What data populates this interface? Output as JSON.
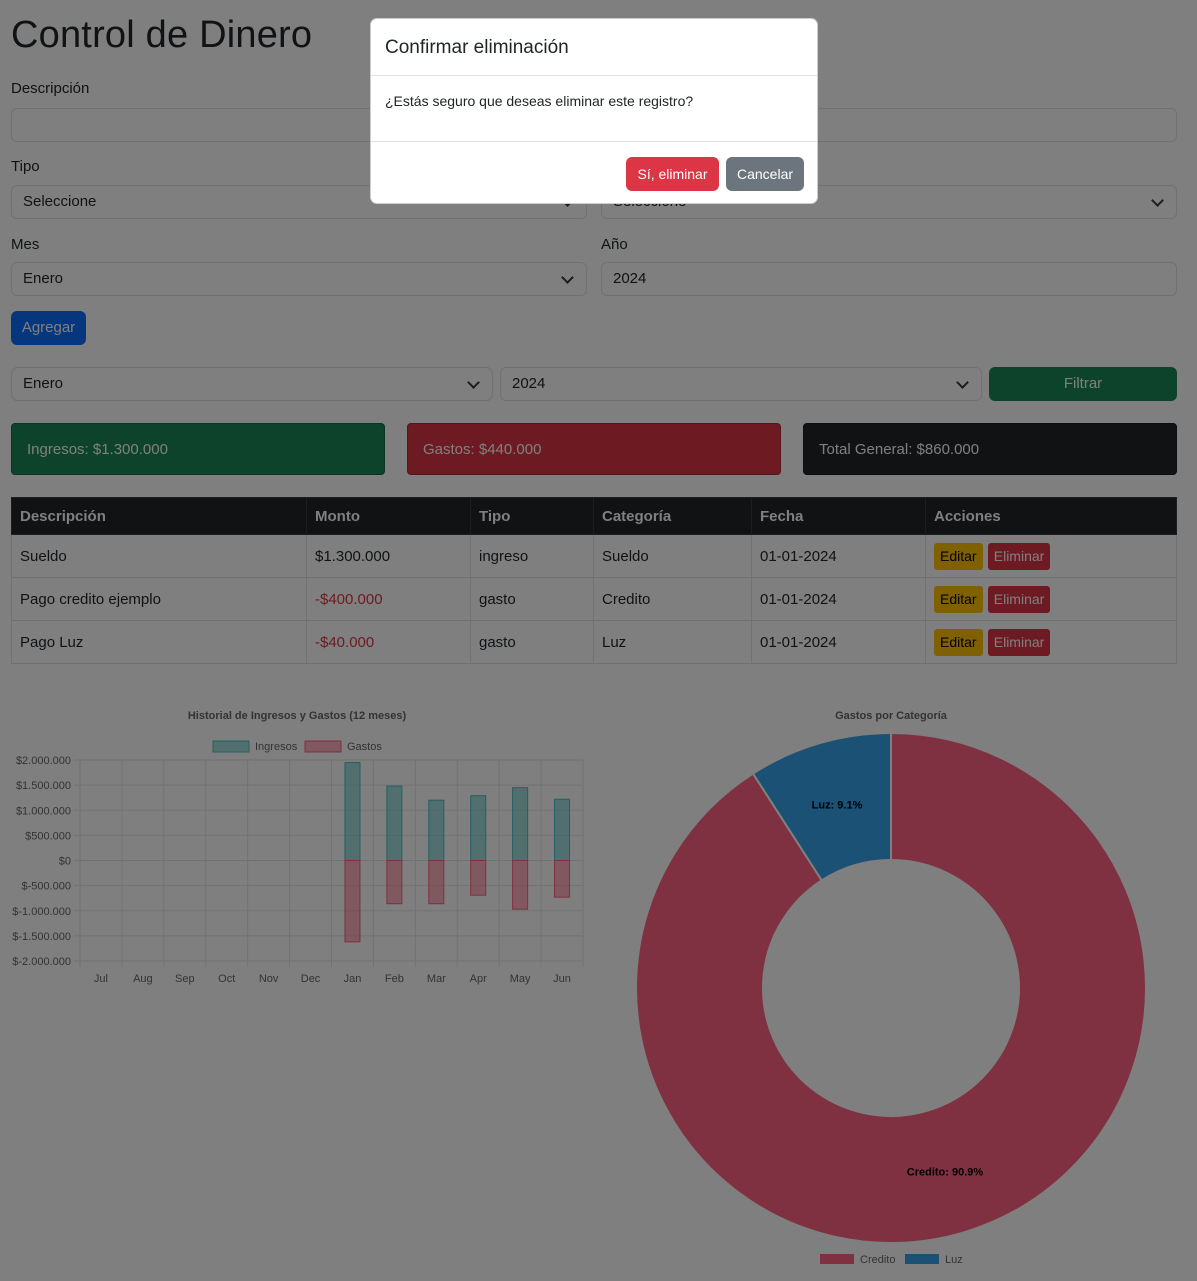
{
  "title": "Control de Dinero",
  "form": {
    "descripcion_label": "Descripción",
    "descripcion_value": "",
    "monto_value": "",
    "tipo_label": "Tipo",
    "tipo_value": "Seleccione",
    "categoria_value": "Seleccione",
    "mes_label": "Mes",
    "mes_value": "Enero",
    "anio_label": "Año",
    "anio_value": "2024",
    "add_button": "Agregar"
  },
  "filter": {
    "mes_value": "Enero",
    "anio_value": "2024",
    "button": "Filtrar"
  },
  "summary": {
    "ingresos": "Ingresos: $1.300.000",
    "gastos": "Gastos: $440.000",
    "total": "Total General: $860.000"
  },
  "table": {
    "headers": [
      "Descripción",
      "Monto",
      "Tipo",
      "Categoría",
      "Fecha",
      "Acciones"
    ],
    "rows": [
      {
        "descripcion": "Sueldo",
        "monto": "$1.300.000",
        "tipo": "ingreso",
        "categoria": "Sueldo",
        "fecha": "01-01-2024"
      },
      {
        "descripcion": "Pago credito ejemplo",
        "monto": "-$400.000",
        "tipo": "gasto",
        "categoria": "Credito",
        "fecha": "01-01-2024"
      },
      {
        "descripcion": "Pago Luz",
        "monto": "-$40.000",
        "tipo": "gasto",
        "categoria": "Luz",
        "fecha": "01-01-2024"
      }
    ],
    "edit_label": "Editar",
    "delete_label": "Eliminar"
  },
  "colors": {
    "ingresos": "#4bc0c0",
    "gastos": "#ff6384",
    "credito": "#ff6384",
    "luz": "#36a2eb"
  },
  "chart_data": [
    {
      "type": "bar",
      "title": "Historial de Ingresos y Gastos (12 meses)",
      "categories": [
        "Jul",
        "Aug",
        "Sep",
        "Oct",
        "Nov",
        "Dec",
        "Jan",
        "Feb",
        "Mar",
        "Apr",
        "May",
        "Jun"
      ],
      "series": [
        {
          "name": "Ingresos",
          "values": [
            0,
            0,
            0,
            0,
            0,
            0,
            1950000,
            1480000,
            1200000,
            1290000,
            1450000,
            1220000
          ]
        },
        {
          "name": "Gastos",
          "values": [
            0,
            0,
            0,
            0,
            0,
            0,
            -1620000,
            -860000,
            -860000,
            -690000,
            -970000,
            -730000
          ]
        }
      ],
      "ylim": [
        -2000000,
        2000000
      ],
      "yticks": [
        "$2.000.000",
        "$1.500.000",
        "$1.000.000",
        "$500.000",
        "$0",
        "$-500.000",
        "$-1.000.000",
        "$-1.500.000",
        "$-2.000.000"
      ],
      "legend": "top",
      "grid": true
    },
    {
      "type": "pie",
      "title": "Gastos por Categoría",
      "labels": [
        "Credito",
        "Luz"
      ],
      "values": [
        90.9,
        9.1
      ],
      "data_labels": [
        "Credito: 90.9%",
        "Luz: 9.1%"
      ],
      "legend": "bottom"
    }
  ],
  "modal": {
    "title": "Confirmar eliminación",
    "body": "¿Estás seguro que deseas eliminar este registro?",
    "confirm": "Sí, eliminar",
    "cancel": "Cancelar"
  }
}
